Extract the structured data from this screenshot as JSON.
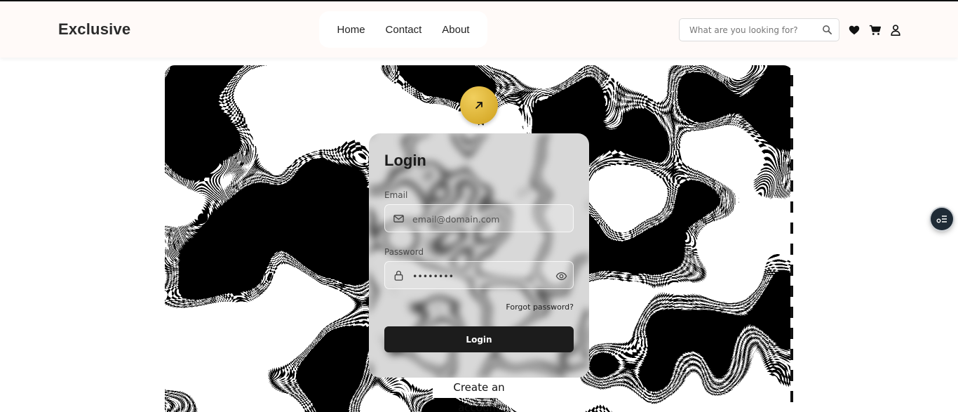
{
  "brand": "Exclusive",
  "nav": [
    "Home",
    "Contact",
    "About"
  ],
  "search": {
    "placeholder": "What are you looking for?"
  },
  "header_icons": [
    "heart-icon",
    "cart-icon",
    "user-icon"
  ],
  "login": {
    "title": "Login",
    "email_label": "Email",
    "email_placeholder": "email@domain.com",
    "password_label": "Password",
    "password_value": "••••••••",
    "forgot": "Forgot password?",
    "submit": "Login",
    "create_account": "Create an account"
  },
  "colors": {
    "accent_gold": "#d9ae2f",
    "button_dark": "#1c1c1c",
    "header_bg": "#fffaf8"
  }
}
